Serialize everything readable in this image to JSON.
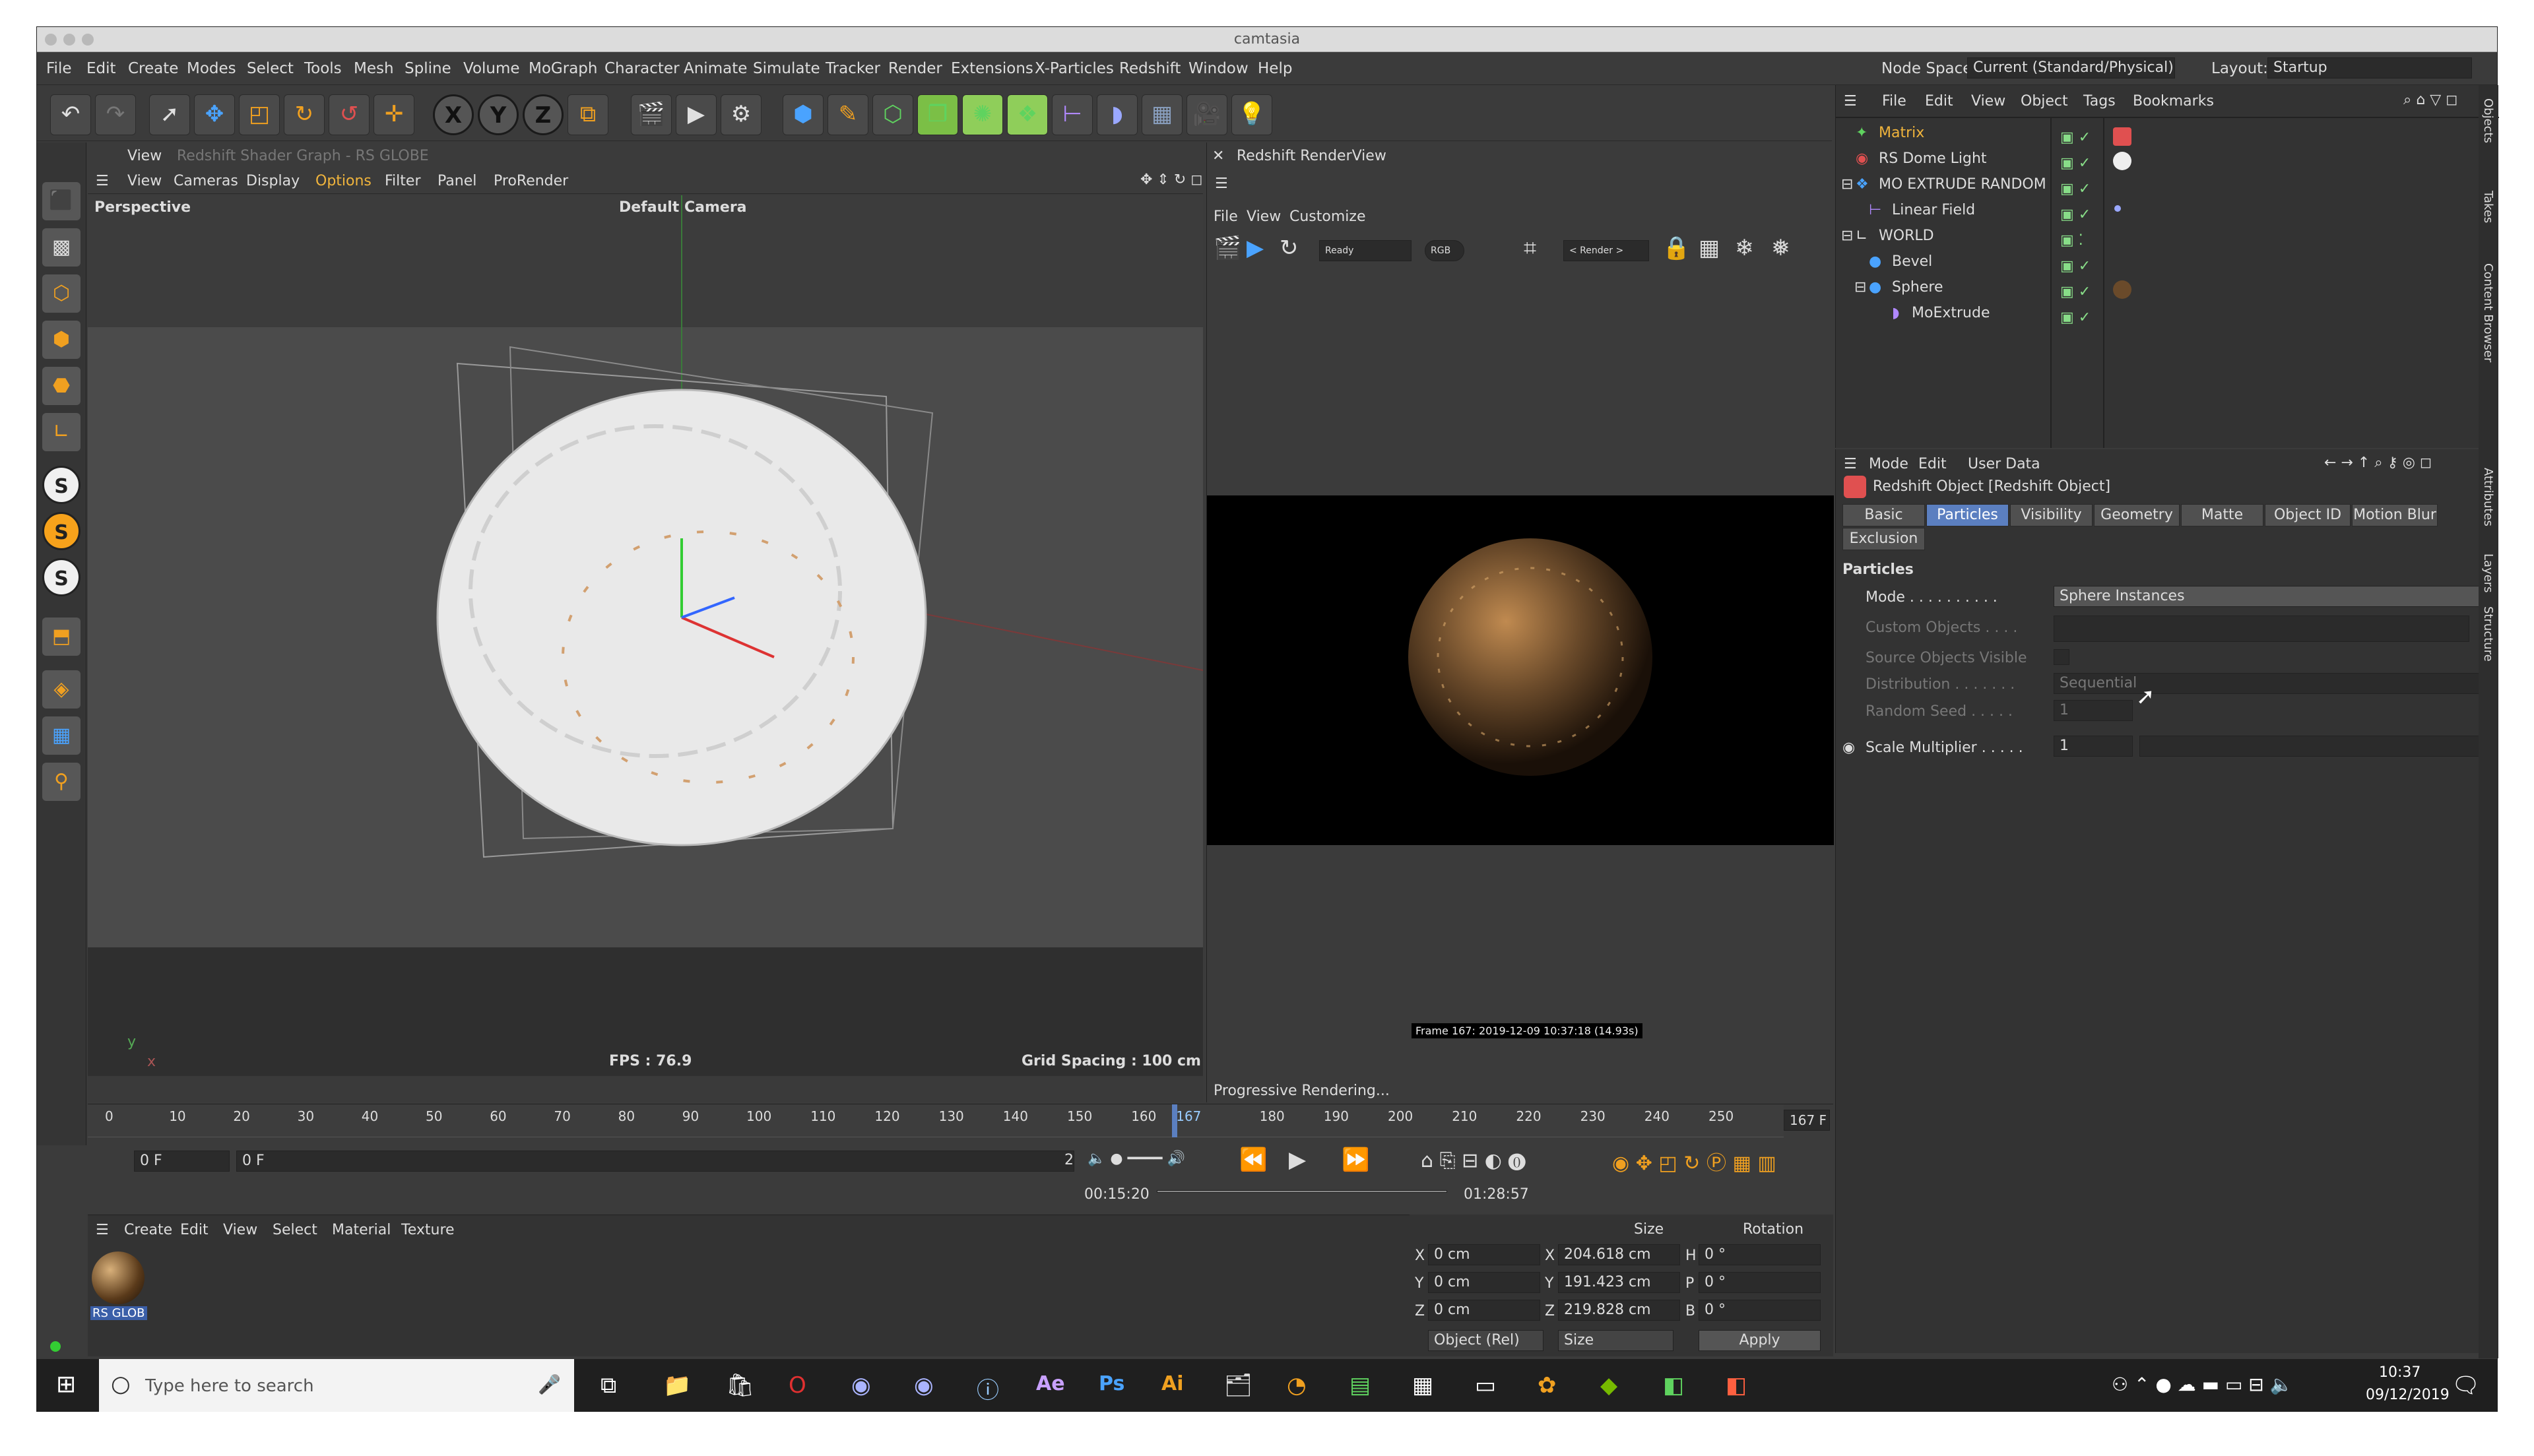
{
  "window": {
    "title": "camtasia"
  },
  "menubar": {
    "items": [
      "File",
      "Edit",
      "Create",
      "Modes",
      "Select",
      "Tools",
      "Mesh",
      "Spline",
      "Volume",
      "MoGraph",
      "Character",
      "Animate",
      "Simulate",
      "Tracker",
      "Render",
      "Extensions",
      "X-Particles",
      "Redshift",
      "Window",
      "Help"
    ],
    "node_space_label": "Node Space:",
    "node_space_value": "Current (Standard/Physical)",
    "layout_label": "Layout:",
    "layout_value": "Startup"
  },
  "toolbar": {
    "axis_x": "X",
    "axis_y": "Y",
    "axis_z": "Z"
  },
  "left_tools": {
    "s1": "S",
    "s2": "S",
    "s3": "S"
  },
  "viewport": {
    "tab_view": "View",
    "tab_title": "Redshift Shader Graph - RS GLOBE",
    "menu": [
      "View",
      "Cameras",
      "Display",
      "Options",
      "Filter",
      "Panel",
      "ProRender"
    ],
    "label_perspective": "Perspective",
    "label_camera": "Default Camera",
    "fps": "FPS : 76.9",
    "grid_spacing": "Grid Spacing : 100 cm"
  },
  "renderview": {
    "title": "Redshift RenderView",
    "menu": [
      "File",
      "View",
      "Customize"
    ],
    "status_dropdown": "Ready",
    "rgb_label": "RGB",
    "render_dropdown": "< Render >",
    "frame_info": "Frame 167: 2019-12-09 10:37:18 (14.93s)",
    "progress": "Progressive Rendering..."
  },
  "object_manager": {
    "menu": [
      "File",
      "Edit",
      "View",
      "Object",
      "Tags",
      "Bookmarks"
    ],
    "objects": [
      "Matrix",
      "RS Dome Light",
      "MO EXTRUDE RANDOM",
      "Linear Field",
      "WORLD",
      "Bevel",
      "Sphere",
      "MoExtrude"
    ]
  },
  "attributes": {
    "menu": [
      "Mode",
      "Edit",
      "User Data"
    ],
    "object_title": "Redshift Object [Redshift Object]",
    "tabs": [
      "Basic",
      "Particles",
      "Visibility",
      "Geometry",
      "Matte",
      "Object ID",
      "Motion Blur",
      "Exclusion"
    ],
    "section": "Particles",
    "mode_label": "Mode . . . . . . . . . .",
    "mode_value": "Sphere Instances",
    "custom_objects_label": "Custom Objects . . . .",
    "source_visible_label": "Source Objects Visible",
    "distribution_label": "Distribution . . . . . . .",
    "distribution_value": "Sequential",
    "random_seed_label": "Random Seed . . . . .",
    "random_seed_value": "1",
    "scale_label": "Scale Multiplier . . . . .",
    "scale_value": "1"
  },
  "timeline": {
    "ticks": [
      "0",
      "10",
      "20",
      "30",
      "40",
      "50",
      "60",
      "70",
      "80",
      "90",
      "100",
      "110",
      "120",
      "130",
      "140",
      "150",
      "160",
      "167",
      "180",
      "190",
      "200",
      "210",
      "220",
      "230",
      "240",
      "250"
    ],
    "frame_end": "167 F",
    "frame_start_field": "0 F",
    "frame_current_field": "0 F",
    "frame_right_field": "2",
    "time_elapsed": "00:15:20",
    "time_total": "01:28:57",
    "current_frame": 167,
    "max_frame": 250
  },
  "material_manager": {
    "menu": [
      "Create",
      "Edit",
      "View",
      "Select",
      "Material",
      "Texture"
    ],
    "material_name": "RS GLOB"
  },
  "coordinates": {
    "col_size": "Size",
    "col_rotation": "Rotation",
    "rows": [
      {
        "axis": "X",
        "pos": "0 cm",
        "size_axis": "X",
        "size": "204.618 cm",
        "rot_axis": "H",
        "rot": "0 °"
      },
      {
        "axis": "Y",
        "pos": "0 cm",
        "size_axis": "Y",
        "size": "191.423 cm",
        "rot_axis": "P",
        "rot": "0 °"
      },
      {
        "axis": "Z",
        "pos": "0 cm",
        "size_axis": "Z",
        "size": "219.828 cm",
        "rot_axis": "B",
        "rot": "0 °"
      }
    ],
    "mode_dropdown": "Object (Rel)",
    "size_dropdown": "Size",
    "apply_button": "Apply"
  },
  "sidebar_tabs": [
    "Objects",
    "Takes",
    "Content Browser",
    "Attributes",
    "Layers",
    "Structure"
  ],
  "taskbar": {
    "search_placeholder": "Type here to search",
    "time": "10:37",
    "date": "09/12/2019"
  },
  "colors": {
    "accent": "#5b7fc0",
    "option_orange": "#f0b43c"
  }
}
